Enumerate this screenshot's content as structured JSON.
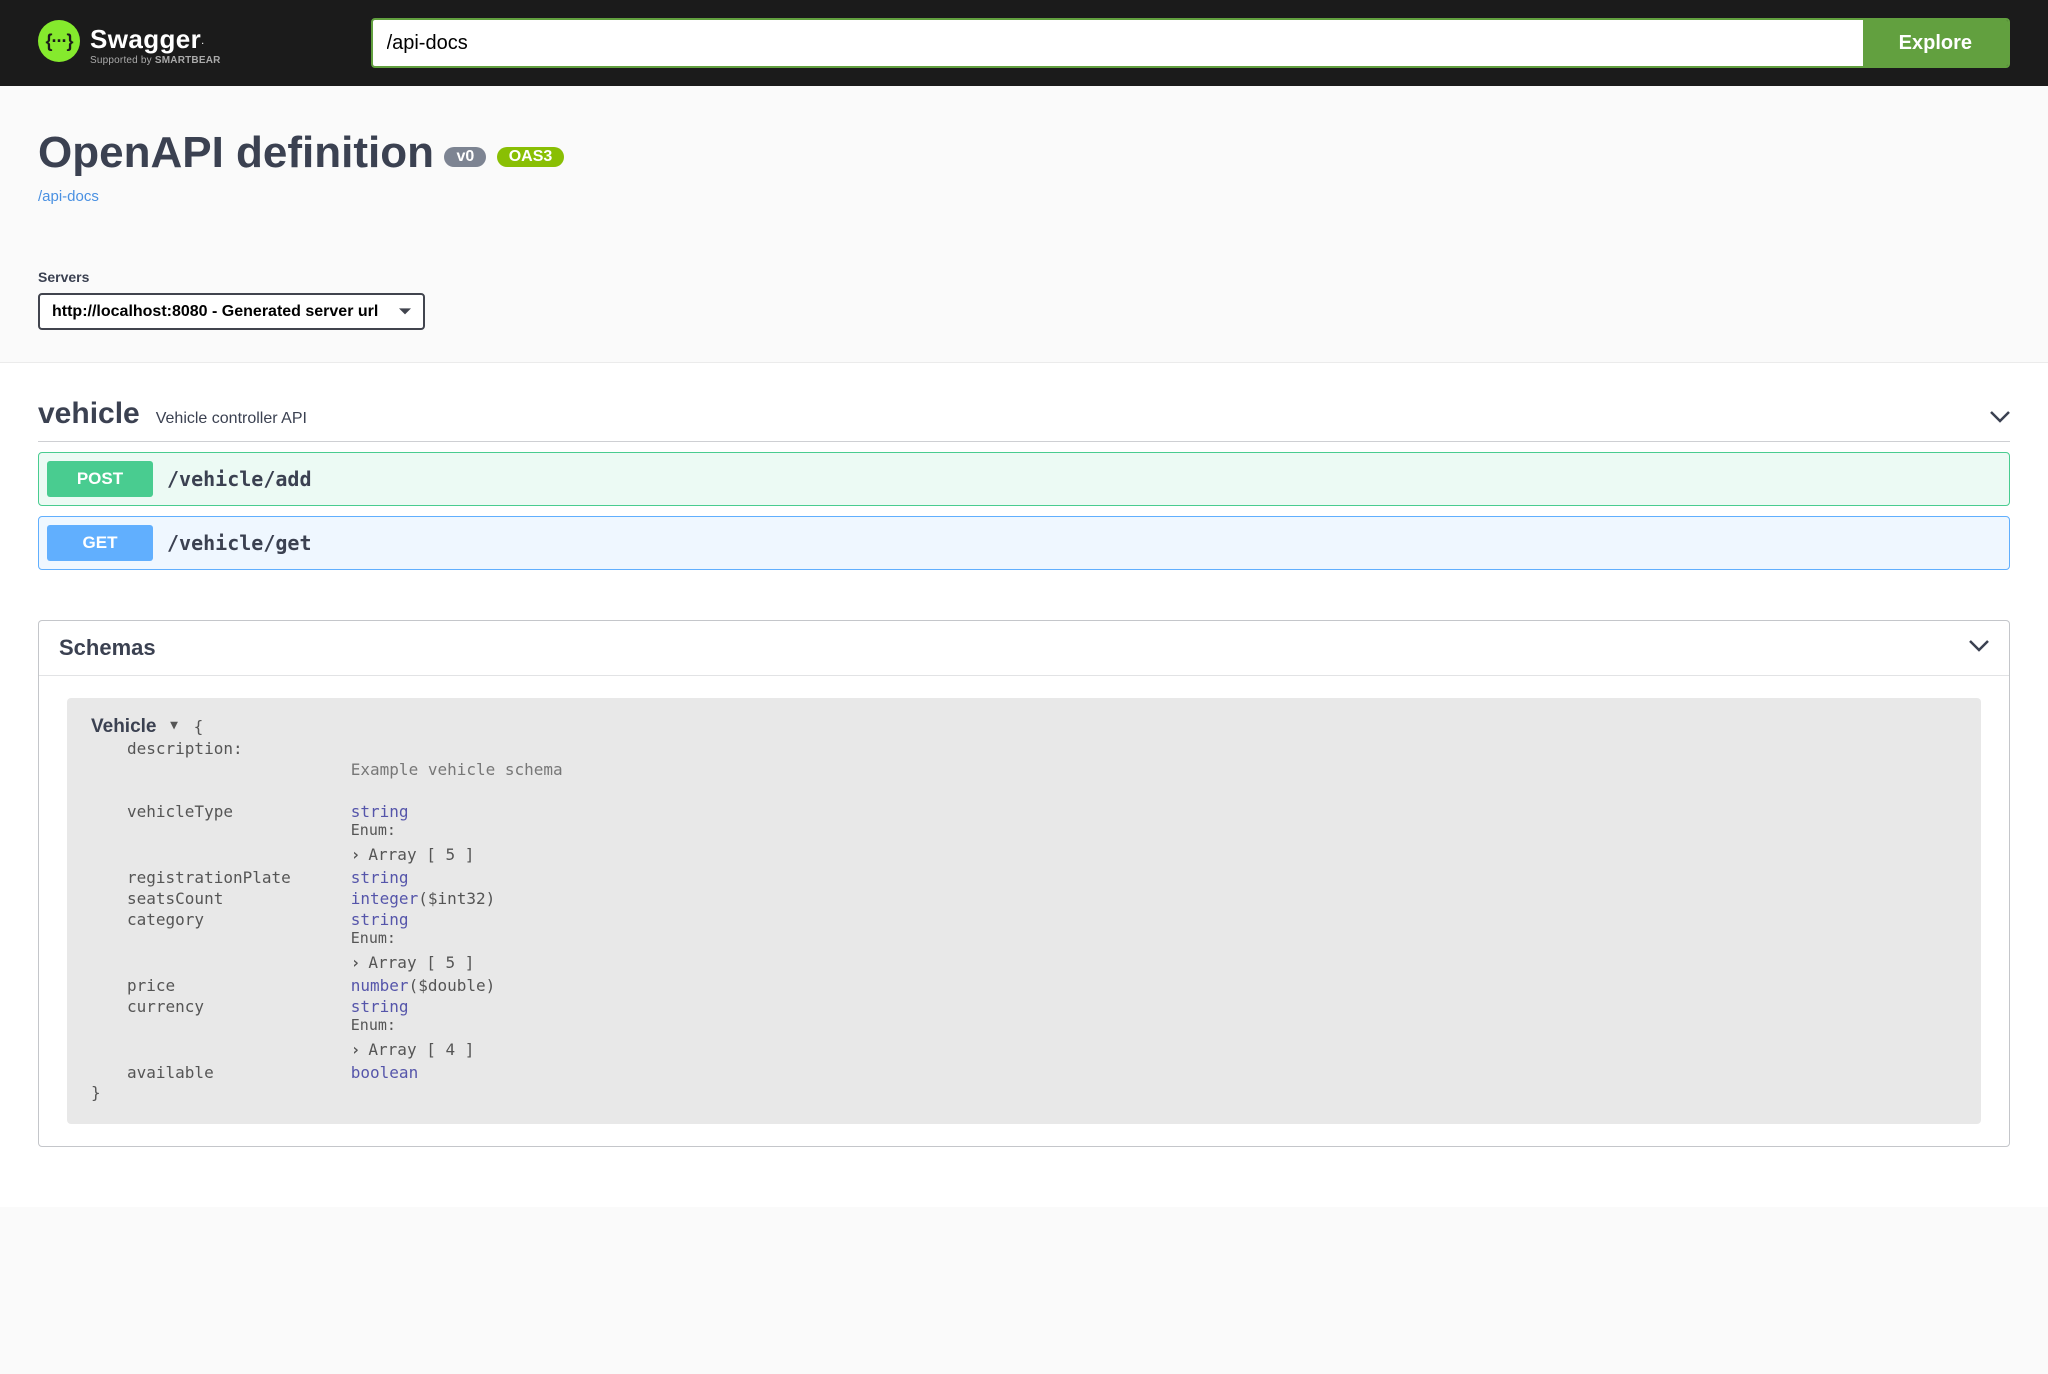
{
  "brand": {
    "name": "Swagger",
    "supportedBy": "Supported by ",
    "supportedByBold": "SMARTBEAR",
    "icon": "{···}"
  },
  "topbar": {
    "urlValue": "/api-docs",
    "exploreLabel": "Explore"
  },
  "info": {
    "title": "OpenAPI definition",
    "versionBadge": "v0",
    "oasBadge": "OAS3",
    "docsUrl": "/api-docs"
  },
  "servers": {
    "label": "Servers",
    "selected": "http://localhost:8080 - Generated server url"
  },
  "tag": {
    "name": "vehicle",
    "description": "Vehicle controller API"
  },
  "operations": [
    {
      "method": "POST",
      "path": "/vehicle/add"
    },
    {
      "method": "GET",
      "path": "/vehicle/get"
    }
  ],
  "schemas": {
    "heading": "Schemas",
    "model": {
      "name": "Vehicle",
      "descriptionKey": "description:",
      "description": "Example vehicle schema",
      "enumLabel": "Enum:",
      "props": {
        "vehicleType": {
          "key": "vehicleType",
          "type": "string",
          "enum": "Array [ 5 ]"
        },
        "registrationPlate": {
          "key": "registrationPlate",
          "type": "string"
        },
        "seatsCount": {
          "key": "seatsCount",
          "type": "integer",
          "format": "($int32)"
        },
        "category": {
          "key": "category",
          "type": "string",
          "enum": "Array [ 5 ]"
        },
        "price": {
          "key": "price",
          "type": "number",
          "format": "($double)"
        },
        "currency": {
          "key": "currency",
          "type": "string",
          "enum": "Array [ 4 ]"
        },
        "available": {
          "key": "available",
          "type": "boolean"
        }
      }
    }
  }
}
